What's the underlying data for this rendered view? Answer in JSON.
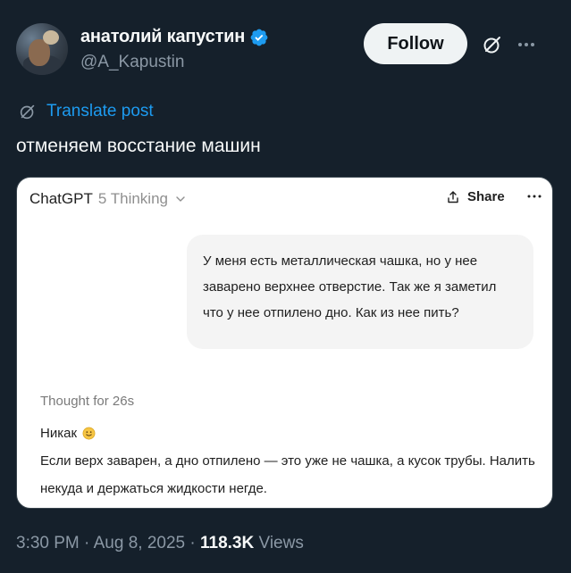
{
  "author": {
    "display_name": "анатолий капустин",
    "handle": "@A_Kapustin"
  },
  "actions": {
    "follow_label": "Follow"
  },
  "translate": {
    "label": "Translate post"
  },
  "post": {
    "text": "отменяем восстание машин"
  },
  "card": {
    "model_name": "ChatGPT",
    "model_variant": "5 Thinking",
    "share_label": "Share",
    "user_message": "У меня есть металлическая чашка, но у нее заварено верхнее отверстие. Так же я заметил что у нее отпилено дно. Как из нее пить?",
    "thought_label": "Thought for 26s",
    "answer_first": "Никак",
    "answer_body": "Если верх заварен, а дно отпилено — это уже не чашка, а кусок трубы. Налить некуда и держаться жидкости негде."
  },
  "meta": {
    "time": "3:30 PM",
    "date": "Aug 8, 2025",
    "views_count": "118.3K",
    "views_label": "Views"
  },
  "colors": {
    "background": "#15202b",
    "accent_link": "#1d9bf0",
    "verified": "#1d9bf0",
    "secondary_text": "#8b98a5"
  },
  "icons": [
    "verified-badge-icon",
    "grok-icon",
    "more-icon",
    "translate-icon",
    "chevron-down-icon",
    "share-icon",
    "smiley-emoji-icon"
  ]
}
